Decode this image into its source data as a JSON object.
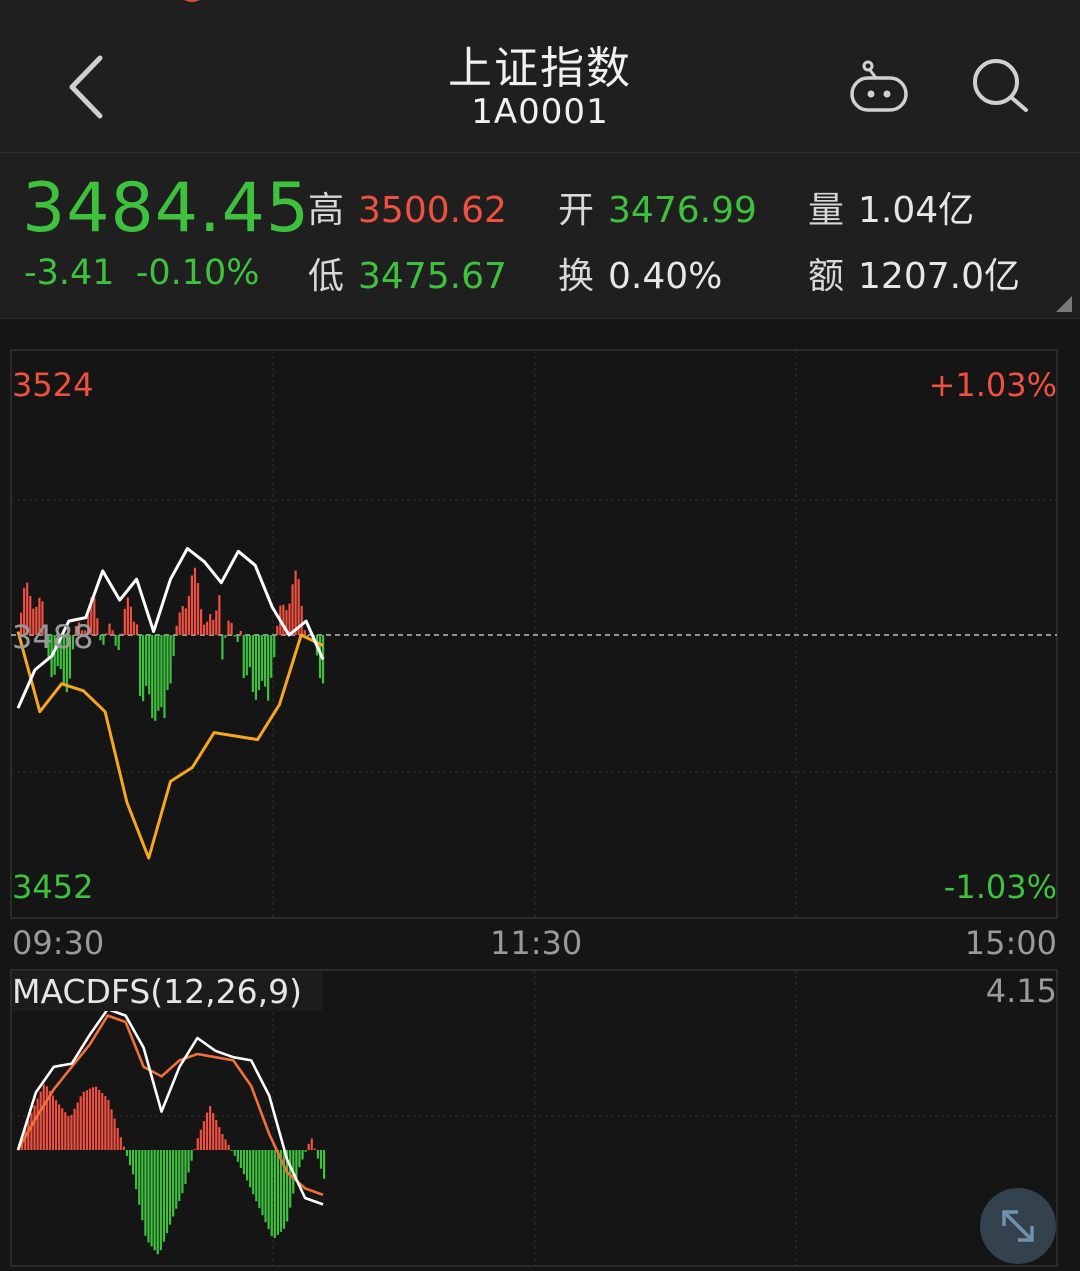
{
  "header": {
    "title": "上证指数",
    "code": "1A0001"
  },
  "quote": {
    "price": "3484.45",
    "change": "-3.41",
    "change_pct": "-0.10%",
    "high_label": "高",
    "high_value": "3500.62",
    "low_label": "低",
    "low_value": "3475.67",
    "open_label": "开",
    "open_value": "3476.99",
    "turnover_label": "换",
    "turnover_value": "0.40%",
    "volume_label": "量",
    "volume_value": "1.04亿",
    "amount_label": "额",
    "amount_value": "1207.0亿"
  },
  "intraday": {
    "y_max_label": "3524",
    "y_min_label": "3452",
    "y_mid_label": "3488",
    "pct_max_label": "+1.03%",
    "pct_min_label": "-1.03%",
    "time_labels": [
      "09:30",
      "11:30",
      "15:00"
    ]
  },
  "macd": {
    "title": "MACDFS(12,26,9)",
    "max_label": "4.15"
  },
  "colors": {
    "up": "#f05040",
    "down": "#3ec23e",
    "price_line": "#ffffff",
    "avg_line": "#f5a623",
    "dea_line": "#f0703a"
  },
  "chart_data": [
    {
      "type": "line",
      "title": "",
      "x": [
        "09:30",
        "11:30",
        "15:00"
      ],
      "ylim": [
        3452,
        3524
      ],
      "y_ref": 3488,
      "series": [
        {
          "values": [
            3477.5,
            3483.0,
            3485.0,
            3490.0,
            3490.5,
            3497.2,
            3493.0,
            3496.0,
            3488.5,
            3496.0,
            3500.4,
            3498.5,
            3495.5,
            3500.0,
            3498.0,
            3492.0,
            3488.0,
            3490.0,
            3484.5
          ]
        },
        {
          "values": [
            3488.5,
            3477.0,
            3481.0,
            3480.0,
            3477.0,
            3464.0,
            3456.0,
            3467.0,
            3469.0,
            3474.0,
            3473.5,
            3473.0,
            3478.0,
            3488.0,
            3486.5
          ]
        }
      ]
    },
    {
      "type": "bar",
      "title": "MACDFS(12,26,9)",
      "ylim": [
        -4.15,
        4.15
      ],
      "series": [
        {
          "values": [
            0.2,
            1.2,
            2.1,
            1.5,
            1.0,
            1.8,
            2.0,
            1.6,
            0.4,
            -0.8,
            -2.8,
            -3.3,
            -2.2,
            -1.2,
            0.3,
            1.4,
            0.5,
            -0.2,
            -1.0,
            -1.9,
            -2.8,
            -2.4,
            -0.6,
            0.4,
            -0.9
          ]
        }
      ]
    }
  ]
}
